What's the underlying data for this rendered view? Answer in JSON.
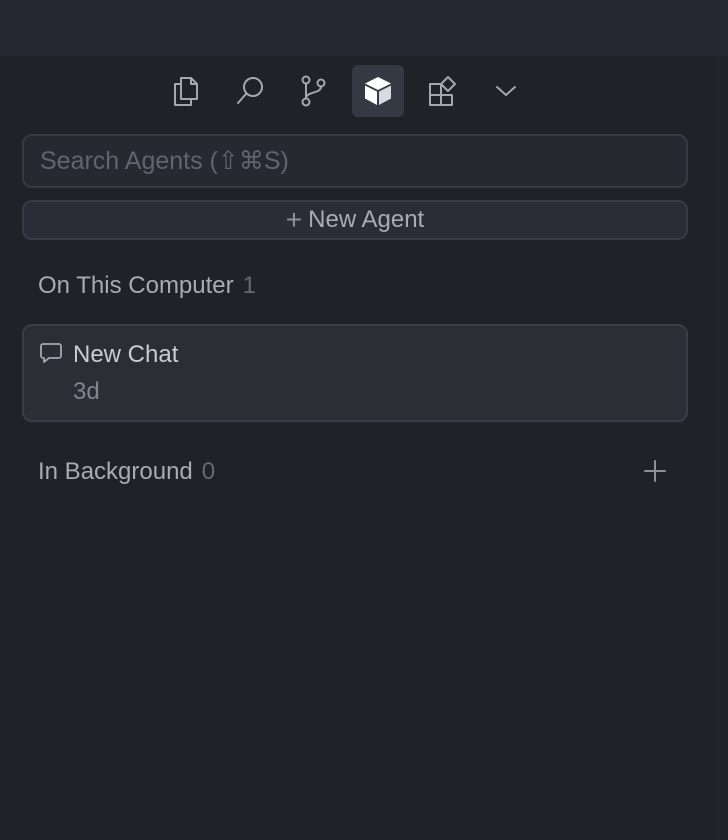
{
  "toolbar": {
    "buttons": [
      {
        "icon": "copy-files-icon",
        "active": false
      },
      {
        "icon": "search-icon",
        "active": false
      },
      {
        "icon": "source-control-icon",
        "active": false
      },
      {
        "icon": "agents-cube-icon",
        "active": true
      },
      {
        "icon": "extensions-icon",
        "active": false
      },
      {
        "icon": "chevron-down-icon",
        "active": false
      }
    ]
  },
  "search": {
    "placeholder": "Search Agents (⇧⌘S)",
    "value": ""
  },
  "new_agent": {
    "label": "New Agent",
    "icon": "plus-icon"
  },
  "sections": {
    "on_this_computer": {
      "label": "On This Computer",
      "count": "1",
      "items": [
        {
          "icon": "chat-bubble-icon",
          "title": "New Chat",
          "time": "3d"
        }
      ]
    },
    "in_background": {
      "label": "In Background",
      "count": "0",
      "add_icon": "plus-icon"
    }
  },
  "colors": {
    "background": "#1f2227",
    "active_button": "#353944",
    "card": "#2b2e35",
    "text_primary": "#c9ccd2",
    "text_muted": "#646a73"
  }
}
